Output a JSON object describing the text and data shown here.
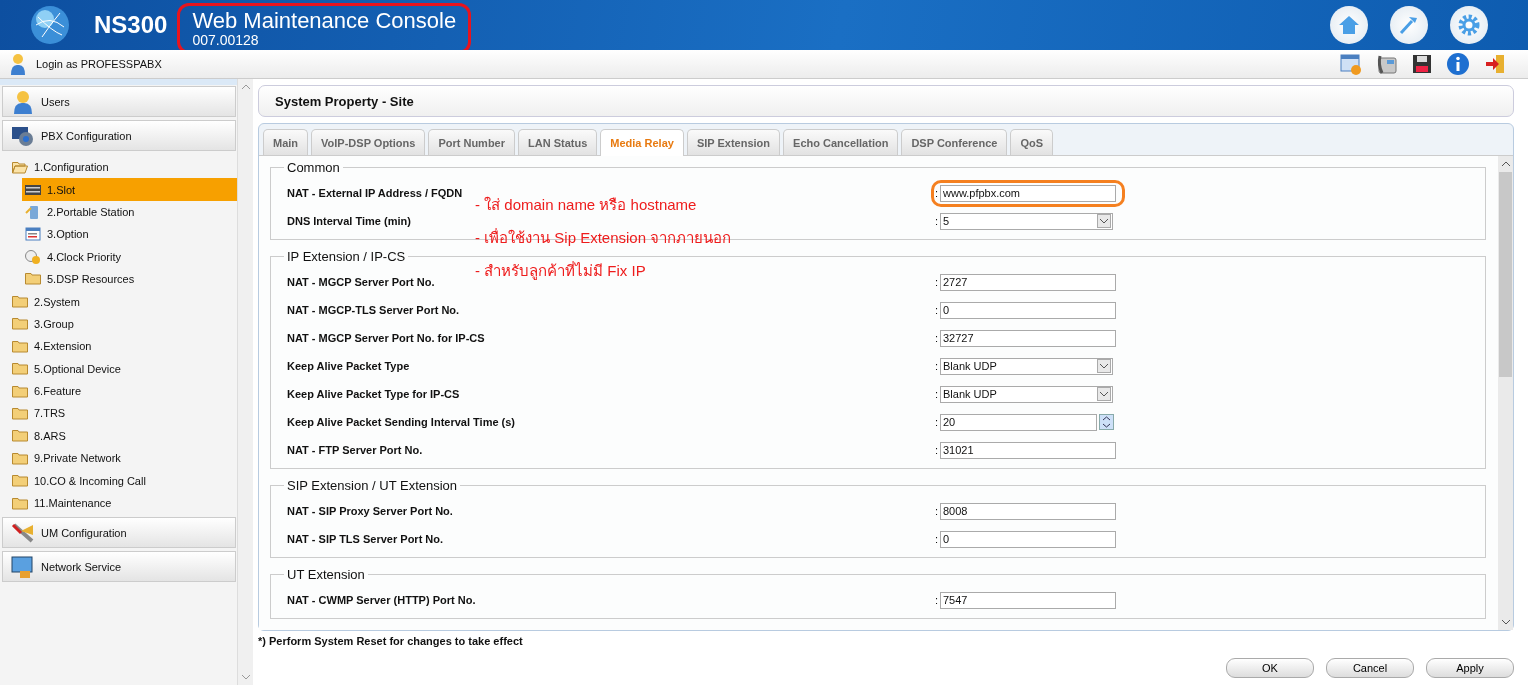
{
  "header": {
    "product": "NS300",
    "title": "Web Maintenance Console",
    "version": "007.00128",
    "highlighted": true
  },
  "login": {
    "text": "Login as PROFESSPABX"
  },
  "sidebar": {
    "sections": [
      {
        "label": "Users",
        "kind": "users"
      },
      {
        "label": "PBX Configuration",
        "kind": "pbx",
        "children": [
          {
            "label": "1.Configuration",
            "expanded": true,
            "selected": false,
            "children": [
              {
                "label": "1.Slot",
                "kind": "slot",
                "selected": true
              },
              {
                "label": "2.Portable Station",
                "kind": "station",
                "selected": false
              },
              {
                "label": "3.Option",
                "kind": "option",
                "selected": false
              },
              {
                "label": "4.Clock Priority",
                "kind": "clock",
                "selected": false
              },
              {
                "label": "5.DSP Resources",
                "kind": "folder",
                "selected": false
              }
            ]
          },
          {
            "label": "2.System",
            "expanded": false,
            "selected": false
          },
          {
            "label": "3.Group",
            "expanded": false,
            "selected": false
          },
          {
            "label": "4.Extension",
            "expanded": false,
            "selected": false
          },
          {
            "label": "5.Optional Device",
            "expanded": false,
            "selected": false
          },
          {
            "label": "6.Feature",
            "expanded": false,
            "selected": false
          },
          {
            "label": "7.TRS",
            "expanded": false,
            "selected": false
          },
          {
            "label": "8.ARS",
            "expanded": false,
            "selected": false
          },
          {
            "label": "9.Private Network",
            "expanded": false,
            "selected": false
          },
          {
            "label": "10.CO & Incoming Call",
            "expanded": false,
            "selected": false
          },
          {
            "label": "11.Maintenance",
            "expanded": false,
            "selected": false
          }
        ]
      },
      {
        "label": "UM Configuration",
        "kind": "um"
      },
      {
        "label": "Network Service",
        "kind": "network"
      }
    ]
  },
  "page_title": "System Property - Site",
  "tabs": [
    {
      "label": "Main",
      "selected": false
    },
    {
      "label": "VoIP-DSP Options",
      "selected": false
    },
    {
      "label": "Port Number",
      "selected": false
    },
    {
      "label": "LAN Status",
      "selected": false
    },
    {
      "label": "Media Relay",
      "selected": true
    },
    {
      "label": "SIP Extension",
      "selected": false
    },
    {
      "label": "Echo Cancellation",
      "selected": false
    },
    {
      "label": "DSP Conference",
      "selected": false
    },
    {
      "label": "QoS",
      "selected": false
    }
  ],
  "sections": [
    {
      "title": "Common",
      "fields": [
        {
          "label": "NAT - External IP Address / FQDN",
          "separator": ":",
          "kind": "text",
          "value": "www.pfpbx.com",
          "highlighted": true
        },
        {
          "label": "DNS Interval Time (min)",
          "separator": ":",
          "kind": "select",
          "value": "5",
          "highlighted": false
        }
      ]
    },
    {
      "title": "IP Extension / IP-CS",
      "fields": [
        {
          "label": "NAT - MGCP Server Port No.",
          "separator": ":",
          "kind": "text",
          "value": "2727",
          "highlighted": false
        },
        {
          "label": "NAT - MGCP-TLS Server Port No.",
          "separator": ":",
          "kind": "text",
          "value": "0",
          "highlighted": false
        },
        {
          "label": "NAT - MGCP Server Port No. for IP-CS",
          "separator": ":",
          "kind": "text",
          "value": "32727",
          "highlighted": false
        },
        {
          "label": "Keep Alive Packet Type",
          "separator": ":",
          "kind": "select",
          "value": "Blank UDP",
          "highlighted": false
        },
        {
          "label": "Keep Alive Packet Type for IP-CS",
          "separator": ":",
          "kind": "select",
          "value": "Blank UDP",
          "highlighted": false
        },
        {
          "label": "Keep Alive Packet Sending Interval Time (s)",
          "separator": ":",
          "kind": "spin",
          "value": "20",
          "highlighted": false
        },
        {
          "label": "NAT - FTP Server Port No.",
          "separator": ":",
          "kind": "text",
          "value": "31021",
          "highlighted": false
        }
      ]
    },
    {
      "title": "SIP Extension / UT Extension",
      "fields": [
        {
          "label": "NAT - SIP Proxy Server Port No.",
          "separator": ":",
          "kind": "text",
          "value": "8008",
          "highlighted": false
        },
        {
          "label": "NAT - SIP TLS Server Port No.",
          "separator": ":",
          "kind": "text",
          "value": "0",
          "highlighted": false
        }
      ]
    },
    {
      "title": "UT Extension",
      "fields": [
        {
          "label": "NAT - CWMP Server (HTTP) Port No.",
          "separator": ":",
          "kind": "text",
          "value": "7547",
          "highlighted": false
        }
      ]
    }
  ],
  "notes": [
    "- ใส่ domain name หรือ hostname",
    "- เพื่อใช้งาน Sip Extension จากภายนอก",
    "- สำหรับลูกค้าที่ไม่มี Fix IP"
  ],
  "footnote": "*) Perform System Reset for changes to take effect",
  "buttons": [
    "OK",
    "Cancel",
    "Apply"
  ]
}
